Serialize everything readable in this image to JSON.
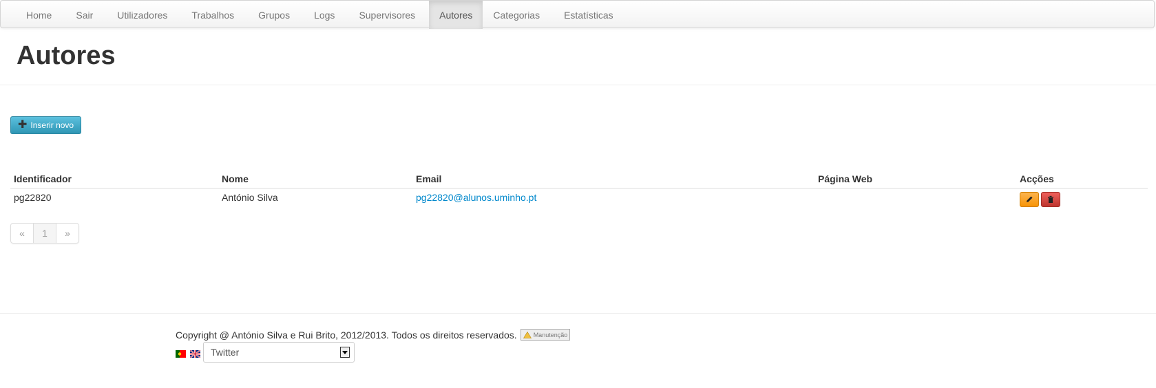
{
  "nav": {
    "items": [
      "Home",
      "Sair",
      "Utilizadores",
      "Trabalhos",
      "Grupos",
      "Logs",
      "Supervisores",
      "Autores",
      "Categorias",
      "Estatísticas"
    ],
    "active": "Autores"
  },
  "page": {
    "title": "Autores"
  },
  "toolbar": {
    "insert_label": "Inserir novo"
  },
  "table": {
    "headers": [
      "Identificador",
      "Nome",
      "Email",
      "Página Web",
      "Acções"
    ],
    "rows": [
      {
        "id": "pg22820",
        "name": "António Silva",
        "email": "pg22820@alunos.uminho.pt",
        "web": ""
      }
    ]
  },
  "pagination": {
    "prev": "«",
    "current": "1",
    "next": "»"
  },
  "footer": {
    "copyright": "Copyright @ António Silva e Rui Brito, 2012/2013. Todos os direitos reservados.",
    "maintenance_label": "Manutenção",
    "social_select_value": "Twitter"
  },
  "icons": {
    "insert": "plus-icon",
    "edit": "pencil-icon",
    "delete": "trash-icon",
    "lang_pt": "flag-pt-icon",
    "lang_en": "flag-uk-icon"
  },
  "colors": {
    "insert_button": "#49afcd",
    "edit_button": "#f89406",
    "delete_button": "#da4f49",
    "link": "#0088cc"
  }
}
